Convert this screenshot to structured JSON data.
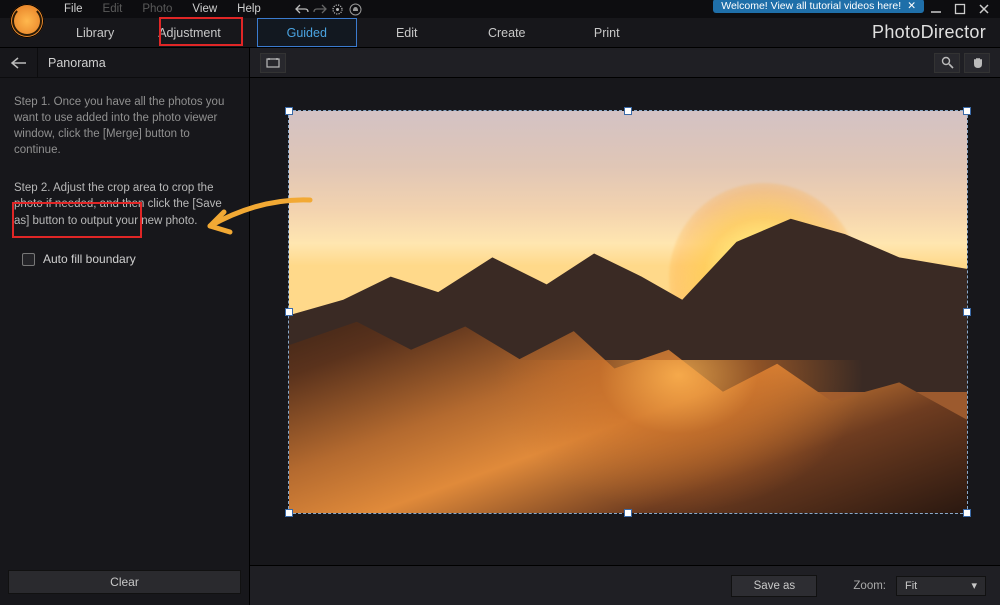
{
  "menu": {
    "items": [
      "File",
      "Edit",
      "Photo",
      "View",
      "Help"
    ],
    "dim_indices": [
      1,
      2
    ]
  },
  "notify": {
    "text": "Welcome! View all tutorial videos here!"
  },
  "tabs": {
    "left": [
      "Library",
      "Adjustment"
    ],
    "right": [
      "Guided",
      "Edit",
      "Create",
      "Print"
    ],
    "active_right": 0,
    "highlighted_left": 1
  },
  "brand": "PhotoDirector",
  "sidebar": {
    "title": "Panorama",
    "step1": "Step 1. Once you have all the photos you want to use added into the photo viewer window, click the [Merge] button to continue.",
    "step2": "Step 2. Adjust the crop area to crop the photo if needed, and then click the [Save as] button to output your new photo.",
    "checkbox": {
      "label": "Auto fill boundary",
      "checked": false
    },
    "footer_btn": "Clear"
  },
  "bottom": {
    "save_btn": "Save as",
    "zoom_label": "Zoom:",
    "zoom_value": "Fit"
  },
  "icons": {
    "undo": "undo",
    "redo": "redo",
    "gear": "gear",
    "bell": "bell",
    "help": "?",
    "min": "—",
    "max": "▢",
    "close": "✕",
    "back": "←",
    "screen": "screen",
    "search": "search",
    "hand": "hand",
    "dropdown": "▾"
  }
}
